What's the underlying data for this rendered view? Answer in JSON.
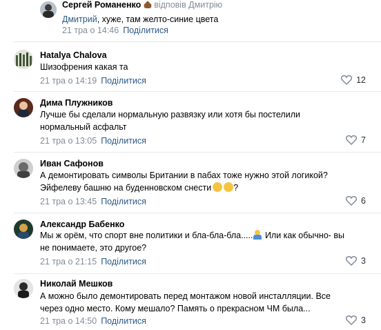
{
  "comments": [
    {
      "author": "Сергей Романенко",
      "reply_to": "відповів Дмитрію",
      "mention": "Дмитрий",
      "text": ", хуже, там желто-синие цвета",
      "time": "21 тра о 14:46",
      "share": "Поділитися",
      "likes": ""
    },
    {
      "author": "Hatalya Chalova",
      "text": "Шизофрения какая та",
      "time": "21 тра о 14:19",
      "share": "Поділитися",
      "likes": "12"
    },
    {
      "author": "Дима Плужников",
      "text": "Лучше бы сделали нормальную развязку или хотя бы постелили нормальный асфальт",
      "time": "21 тра о 13:05",
      "share": "Поділитися",
      "likes": "7"
    },
    {
      "author": "Иван Сафонов",
      "text_line1": "А демонтировать символы Британии в пабах тоже нужно этой логикой?",
      "text_line2": "Эйфелеву башню на буденновском снести",
      "text_suffix": "?",
      "time": "21 тра о 13:45",
      "share": "Поділитися",
      "likes": "6"
    },
    {
      "author": "Александр Бабенко",
      "text_line1": "Мы ж орём, что спорт вне политики и бла-бла-бла.....",
      "text_line1b": " Или как обычно- вы",
      "text_line2": "не понимаете, это другое?",
      "time": "21 тра о 21:15",
      "share": "Поділитися",
      "likes": "3"
    },
    {
      "author": "Николай Мешков",
      "text": "А можно было демонтировать перед монтажом новой инсталляции. Все через одно место. Кому мешало? Память о прекрасном ЧМ была...",
      "time": "21 тра о 14:50",
      "share": "Поділитися",
      "likes": "3"
    }
  ],
  "colors": {
    "link": "#2a5885",
    "meta": "#818c99",
    "divider": "#e7e8ec",
    "heart": "#818c99"
  }
}
